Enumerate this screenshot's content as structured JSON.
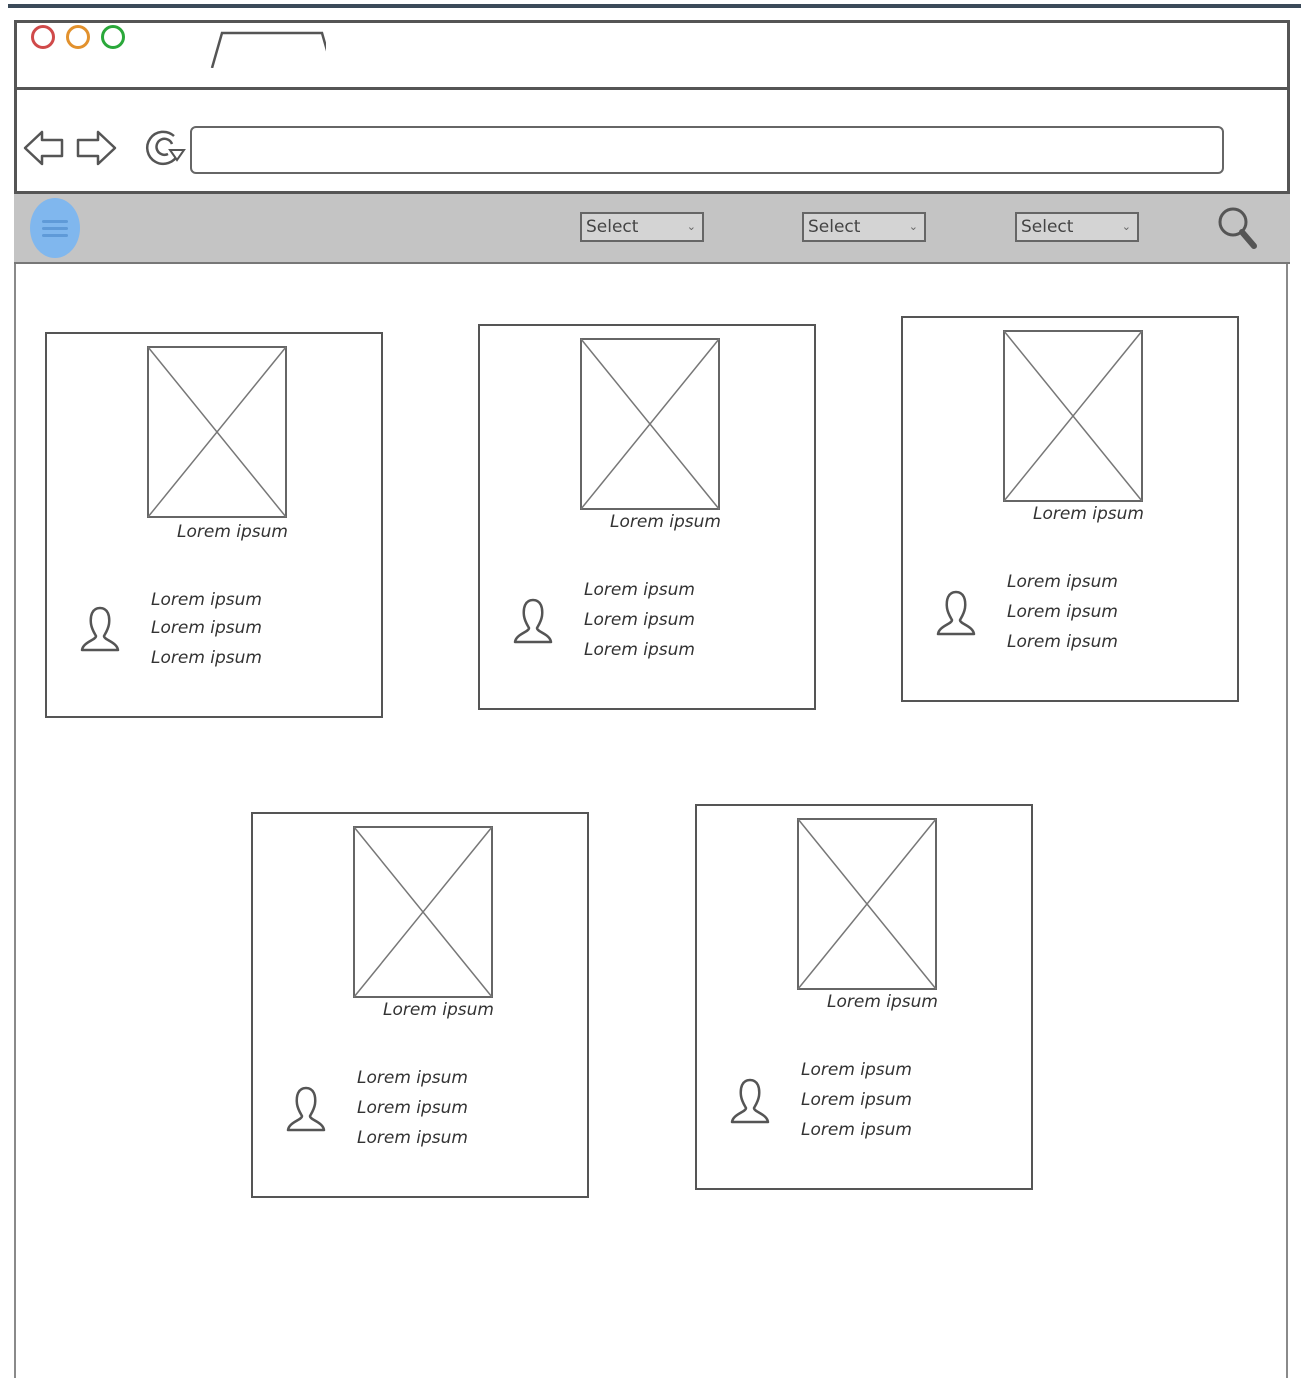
{
  "titlebar": {
    "window_controls": [
      {
        "name": "close",
        "color": "#d04a4a"
      },
      {
        "name": "minimize",
        "color": "#e2912d"
      },
      {
        "name": "maximize",
        "color": "#2aa83a"
      }
    ]
  },
  "addressbar": {
    "url_value": "",
    "url_placeholder": ""
  },
  "menubar": {
    "menu_icon": "hamburger-icon",
    "accent": "#80b7ee",
    "selects": [
      {
        "label": "Select"
      },
      {
        "label": "Select"
      },
      {
        "label": "Select"
      }
    ],
    "search_icon": "search-icon"
  },
  "cards": [
    {
      "caption": "Lorem ipsum",
      "lines": [
        "Lorem ipsum",
        "Lorem ipsum",
        "Lorem ipsum"
      ]
    },
    {
      "caption": "Lorem ipsum",
      "lines": [
        "Lorem ipsum",
        "Lorem ipsum",
        "Lorem ipsum"
      ]
    },
    {
      "caption": "Lorem ipsum",
      "lines": [
        "Lorem ipsum",
        "Lorem ipsum",
        "Lorem ipsum"
      ]
    },
    {
      "caption": "Lorem ipsum",
      "lines": [
        "Lorem ipsum",
        "Lorem ipsum",
        "Lorem ipsum"
      ]
    },
    {
      "caption": "Lorem ipsum",
      "lines": [
        "Lorem ipsum",
        "Lorem ipsum",
        "Lorem ipsum"
      ]
    }
  ]
}
